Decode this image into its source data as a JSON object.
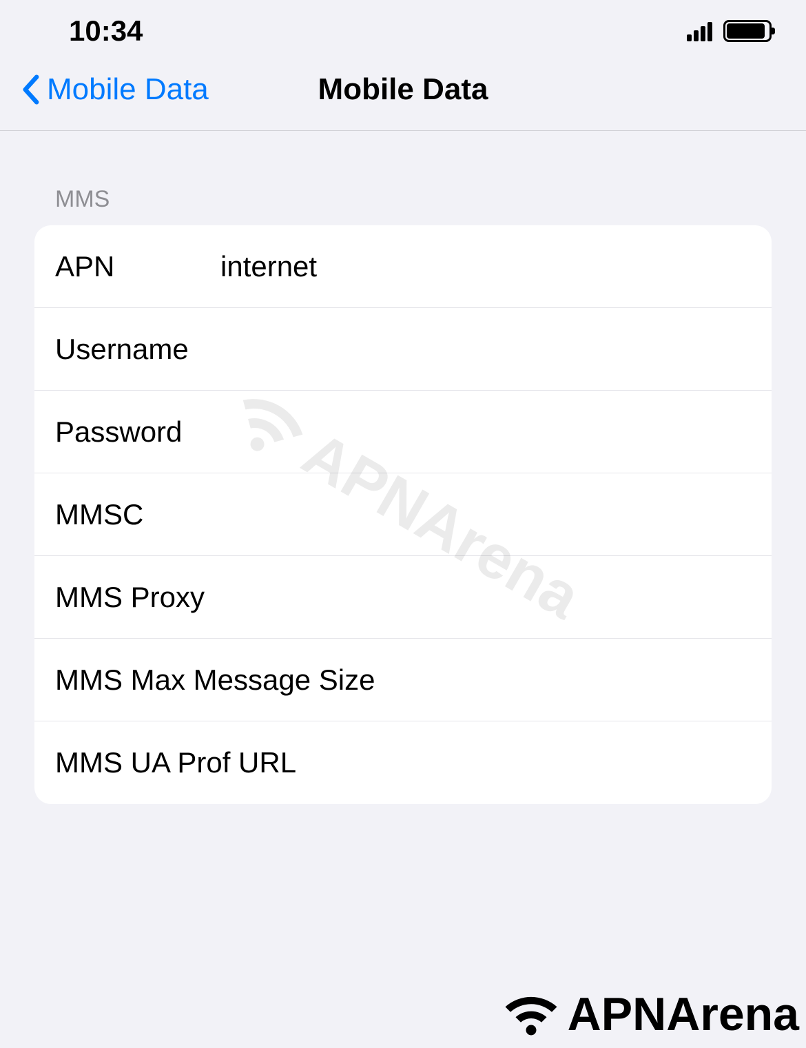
{
  "status": {
    "time": "10:34"
  },
  "nav": {
    "back_label": "Mobile Data",
    "title": "Mobile Data"
  },
  "section": {
    "header": "MMS",
    "rows": [
      {
        "label": "APN",
        "value": "internet"
      },
      {
        "label": "Username",
        "value": ""
      },
      {
        "label": "Password",
        "value": ""
      },
      {
        "label": "MMSC",
        "value": ""
      },
      {
        "label": "MMS Proxy",
        "value": ""
      },
      {
        "label": "MMS Max Message Size",
        "value": ""
      },
      {
        "label": "MMS UA Prof URL",
        "value": ""
      }
    ]
  },
  "watermark": {
    "text": "APNArena"
  },
  "footer": {
    "logo_text": "APNArena"
  }
}
